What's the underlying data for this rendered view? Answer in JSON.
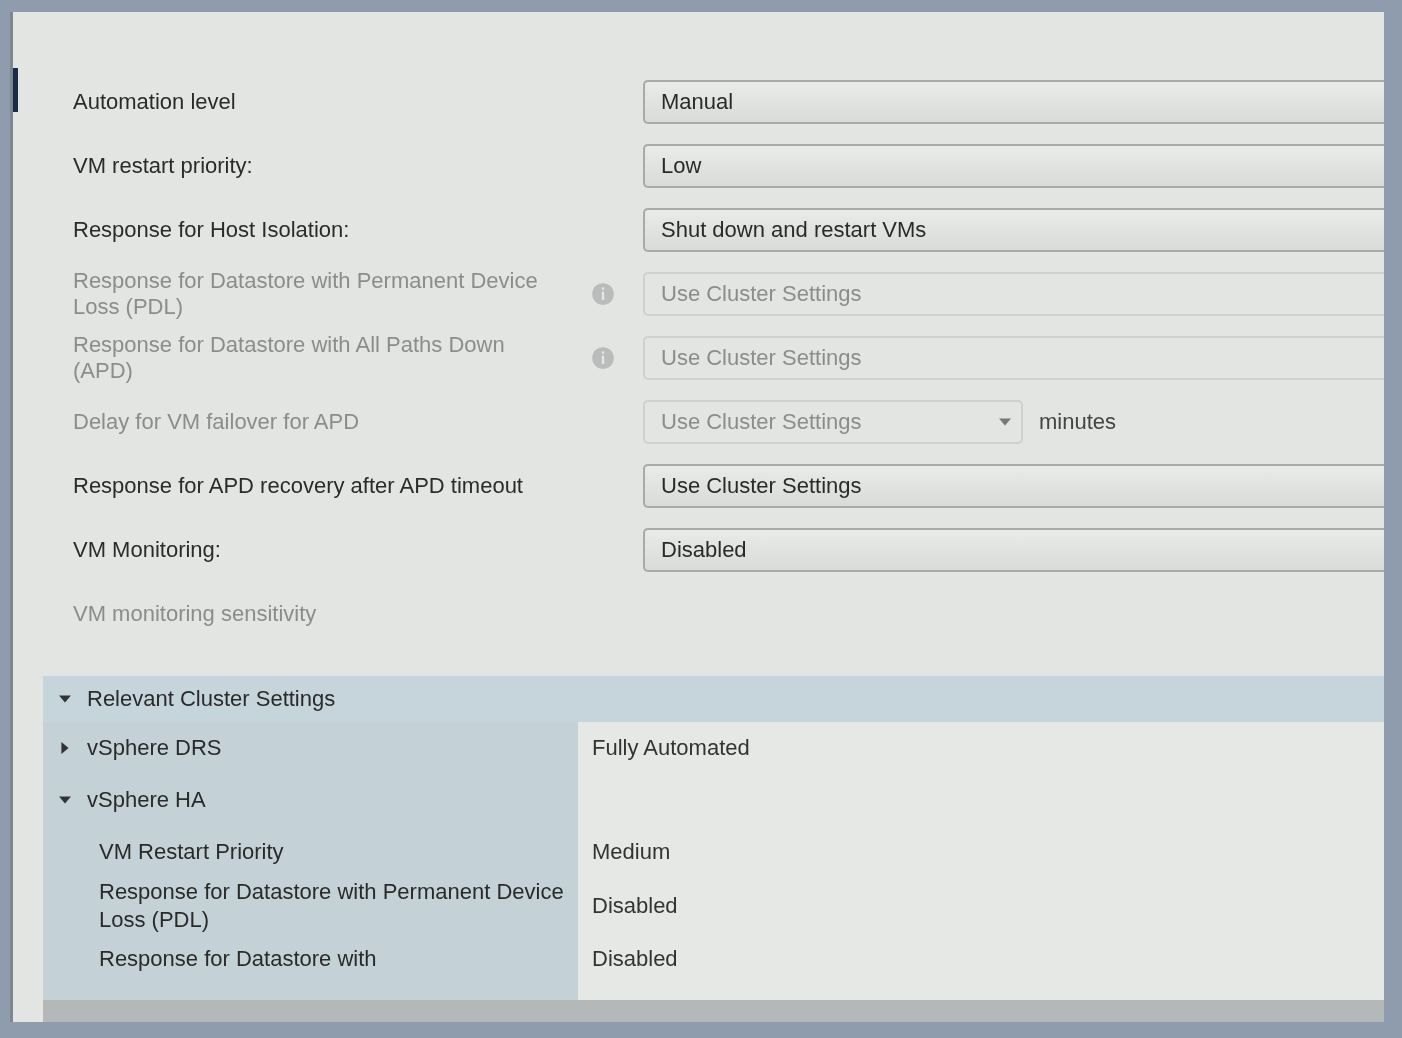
{
  "settings": [
    {
      "label": "Automation level",
      "disabled": false,
      "info": false,
      "field": {
        "kind": "select",
        "value": "Manual"
      }
    },
    {
      "label": "VM restart priority:",
      "disabled": false,
      "info": false,
      "field": {
        "kind": "select",
        "value": "Low"
      }
    },
    {
      "label": "Response for Host Isolation:",
      "disabled": false,
      "info": false,
      "field": {
        "kind": "select",
        "value": "Shut down and restart VMs"
      }
    },
    {
      "label": "Response for Datastore with Permanent Device Loss (PDL)",
      "disabled": true,
      "info": true,
      "field": {
        "kind": "select",
        "value": "Use Cluster Settings"
      }
    },
    {
      "label": "Response for Datastore with All Paths Down (APD)",
      "disabled": true,
      "info": true,
      "field": {
        "kind": "select",
        "value": "Use Cluster Settings"
      }
    },
    {
      "label": "Delay for VM failover for APD",
      "disabled": true,
      "info": false,
      "field": {
        "kind": "select-unit",
        "value": "Use Cluster Settings",
        "unit": "minutes"
      }
    },
    {
      "label": "Response for APD recovery after APD timeout",
      "disabled": false,
      "info": false,
      "field": {
        "kind": "select",
        "value": "Use Cluster Settings"
      }
    },
    {
      "label": "VM Monitoring:",
      "disabled": false,
      "info": false,
      "field": {
        "kind": "select",
        "value": "Disabled"
      }
    },
    {
      "label": "VM monitoring sensitivity",
      "disabled": true,
      "info": false
    }
  ],
  "cluster_settings": {
    "title": "Relevant Cluster Settings",
    "expanded": true,
    "groups": [
      {
        "name": "vSphere DRS",
        "expanded": false,
        "value": "Fully Automated"
      },
      {
        "name": "vSphere HA",
        "expanded": true,
        "children": [
          {
            "label": "VM Restart Priority",
            "value": "Medium"
          },
          {
            "label": "Response for Datastore with Permanent Device Loss (PDL)",
            "value": "Disabled"
          },
          {
            "label": "Response for Datastore with",
            "value": "Disabled"
          }
        ]
      }
    ]
  }
}
